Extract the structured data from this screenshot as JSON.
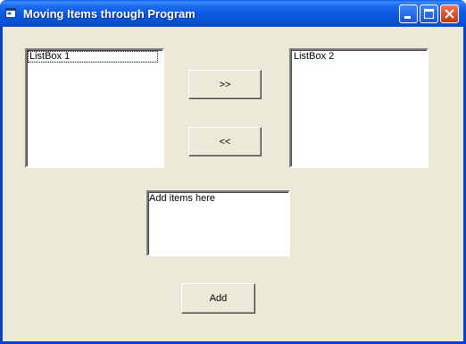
{
  "window": {
    "title": "Moving Items through Program"
  },
  "listbox1": {
    "items": [
      "ListBox 1"
    ]
  },
  "listbox2": {
    "items": [
      "ListBox 2"
    ]
  },
  "buttons": {
    "move_right_label": ">>",
    "move_left_label": "<<",
    "add_label": "Add"
  },
  "input": {
    "value": "Add items here"
  },
  "colors": {
    "titlebar": "#0a57de",
    "face": "#ece9d8",
    "close_button": "#d8552e"
  },
  "icons": {
    "app": "window-icon",
    "minimize": "minimize-icon",
    "maximize": "maximize-icon",
    "close": "close-icon"
  }
}
